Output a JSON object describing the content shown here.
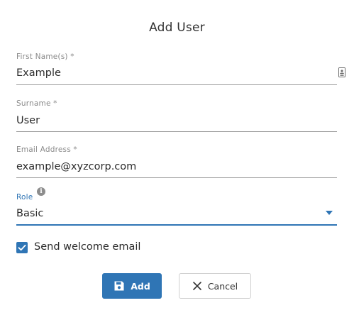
{
  "dialog": {
    "title": "Add User"
  },
  "fields": {
    "first_name": {
      "label": "First Name(s) *",
      "value": "Example"
    },
    "surname": {
      "label": "Surname *",
      "value": "User"
    },
    "email": {
      "label": "Email Address *",
      "value": "example@xyzcorp.com"
    },
    "role": {
      "label": "Role",
      "value": "Basic"
    }
  },
  "checkbox": {
    "label": "Send welcome email",
    "checked": true
  },
  "buttons": {
    "add_label": "Add",
    "cancel_label": "Cancel"
  },
  "colors": {
    "accent": "#2f75b5",
    "label_gray": "#8a8a8a",
    "underline": "#9a9a9a"
  },
  "icons": {
    "first_name_field": "contact-card-icon",
    "role_info": "info-icon",
    "role_dropdown": "caret-down-icon",
    "add_button": "save-icon",
    "cancel_button": "close-icon"
  }
}
